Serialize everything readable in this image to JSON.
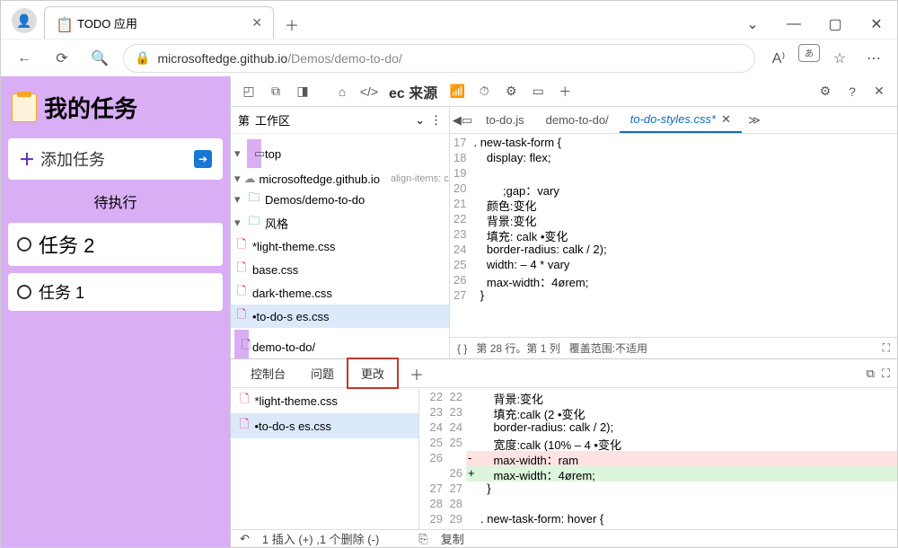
{
  "browser": {
    "tab_title": "TODO 应用",
    "url_host": "microsoftedge.github.io",
    "url_path": "/Demos/demo-to-do/"
  },
  "page": {
    "title": "我的任务",
    "add_task": "添加任务",
    "pending_header": "待执行",
    "tasks": [
      "任务 2",
      "任务 1"
    ]
  },
  "devtools": {
    "tab_label": "ec 来源",
    "nav": {
      "page": "第",
      "workspace": "工作区",
      "tree": {
        "top": "top",
        "origin": "microsoftedge.github.io",
        "overlay": "align-items: center",
        "folder1": "Demos/demo-to-do",
        "folder2": "风格",
        "files": [
          "*light-theme.css",
          "base.css",
          "dark-theme.css",
          "•to-do-s es.css"
        ],
        "lastfile": "demo-to-do/"
      }
    },
    "open_tabs": [
      "to-do.js",
      "demo-to-do/",
      "to-do-styles.css*"
    ],
    "code": {
      "start": 17,
      "lines": [
        ". new-task-form {",
        "    display: flex;",
        "",
        "         ;gap：vary",
        "    颜色:变化",
        "    背景:变化",
        "    填充: calk •变化",
        "    border-radius: calk / 2);",
        "    width: – 4 * vary",
        "    max-width：4ørem;",
        "  }"
      ]
    },
    "status": {
      "braces": "{ }",
      "pos": "第 28 行。第 1 列",
      "coverage": "覆盖范围:不适用"
    }
  },
  "drawer": {
    "tabs": [
      "控制台",
      "问题",
      "更改"
    ],
    "files": [
      "*light-theme.css",
      "•to-do-s es.css"
    ],
    "diff": [
      {
        "o": "22",
        "n": "22",
        "t": "    背景:变化"
      },
      {
        "o": "23",
        "n": "23",
        "t": "    填充:calk (2 •变化"
      },
      {
        "o": "24",
        "n": "24",
        "t": "    border-radius: calk / 2);"
      },
      {
        "o": "25",
        "n": "25",
        "t": "    宽度:calk (10% – 4 •变化"
      },
      {
        "o": "26",
        "n": "",
        "t": "    max-width：ram",
        "k": "del"
      },
      {
        "o": "",
        "n": "26",
        "t": "    max-width：4ørem;",
        "k": "add"
      },
      {
        "o": "27",
        "n": "27",
        "t": "  }"
      },
      {
        "o": "28",
        "n": "28",
        "t": ""
      },
      {
        "o": "29",
        "n": "29",
        "t": ". new-task-form: hover {"
      }
    ],
    "footer": {
      "undo": "↶",
      "summary": "1 插入 (+) ,1 个删除 (-)",
      "copy": "复制"
    }
  }
}
